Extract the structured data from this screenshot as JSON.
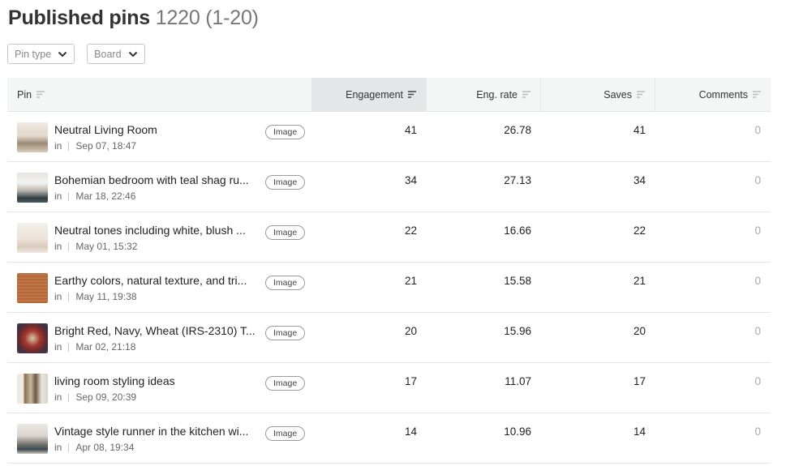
{
  "header": {
    "title": "Published pins",
    "count": "1220 (1-20)"
  },
  "filters": {
    "pin_type": "Pin type",
    "board": "Board"
  },
  "columns": {
    "pin": "Pin",
    "engagement": "Engagement",
    "eng_rate": "Eng. rate",
    "saves": "Saves",
    "comments": "Comments"
  },
  "rows": [
    {
      "title": "Neutral Living Room",
      "prefix": "in",
      "date": "Sep 07, 18:47",
      "type": "Image",
      "engagement": "41",
      "eng_rate": "26.78",
      "saves": "41",
      "comments": "0"
    },
    {
      "title": "Bohemian bedroom with teal shag ru...",
      "prefix": "in",
      "date": "Mar 18, 22:46",
      "type": "Image",
      "engagement": "34",
      "eng_rate": "27.13",
      "saves": "34",
      "comments": "0"
    },
    {
      "title": "Neutral tones including white, blush ...",
      "prefix": "in",
      "date": "May 01, 15:32",
      "type": "Image",
      "engagement": "22",
      "eng_rate": "16.66",
      "saves": "22",
      "comments": "0"
    },
    {
      "title": "Earthy colors, natural texture, and tri...",
      "prefix": "in",
      "date": "May 11, 19:38",
      "type": "Image",
      "engagement": "21",
      "eng_rate": "15.58",
      "saves": "21",
      "comments": "0"
    },
    {
      "title": "Bright Red, Navy, Wheat (IRS-2310) T...",
      "prefix": "in",
      "date": "Mar 02, 21:18",
      "type": "Image",
      "engagement": "20",
      "eng_rate": "15.96",
      "saves": "20",
      "comments": "0"
    },
    {
      "title": "living room styling ideas",
      "prefix": "in",
      "date": "Sep 09, 20:39",
      "type": "Image",
      "engagement": "17",
      "eng_rate": "11.07",
      "saves": "17",
      "comments": "0"
    },
    {
      "title": "Vintage style runner in the kitchen wi...",
      "prefix": "in",
      "date": "Apr 08, 19:34",
      "type": "Image",
      "engagement": "14",
      "eng_rate": "10.96",
      "saves": "14",
      "comments": "0"
    }
  ]
}
